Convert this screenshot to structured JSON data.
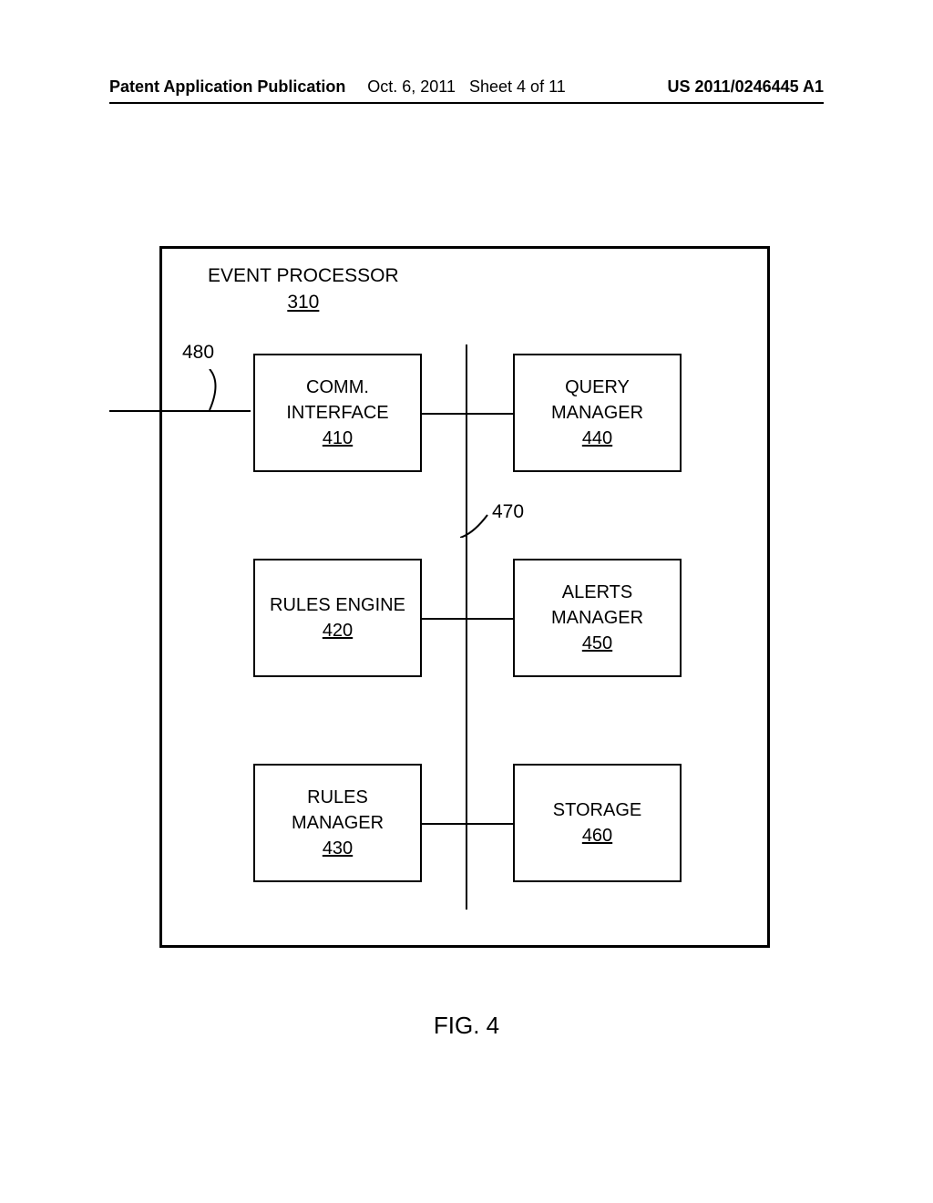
{
  "header": {
    "left": "Patent Application Publication",
    "center_date": "Oct. 6, 2011",
    "center_sheet": "Sheet 4 of 11",
    "right": "US 2011/0246445 A1"
  },
  "processor": {
    "title": "EVENT PROCESSOR",
    "ref": "310"
  },
  "blocks": {
    "comm_interface": {
      "label1": "COMM.",
      "label2": "INTERFACE",
      "ref": "410"
    },
    "query_manager": {
      "label1": "QUERY",
      "label2": "MANAGER",
      "ref": "440"
    },
    "rules_engine": {
      "label1": "RULES ENGINE",
      "ref": "420"
    },
    "alerts_manager": {
      "label1": "ALERTS",
      "label2": "MANAGER",
      "ref": "450"
    },
    "rules_manager": {
      "label1": "RULES",
      "label2": "MANAGER",
      "ref": "430"
    },
    "storage": {
      "label1": "STORAGE",
      "ref": "460"
    }
  },
  "leaders": {
    "bus": "470",
    "external": "480"
  },
  "figure": "FIG. 4"
}
